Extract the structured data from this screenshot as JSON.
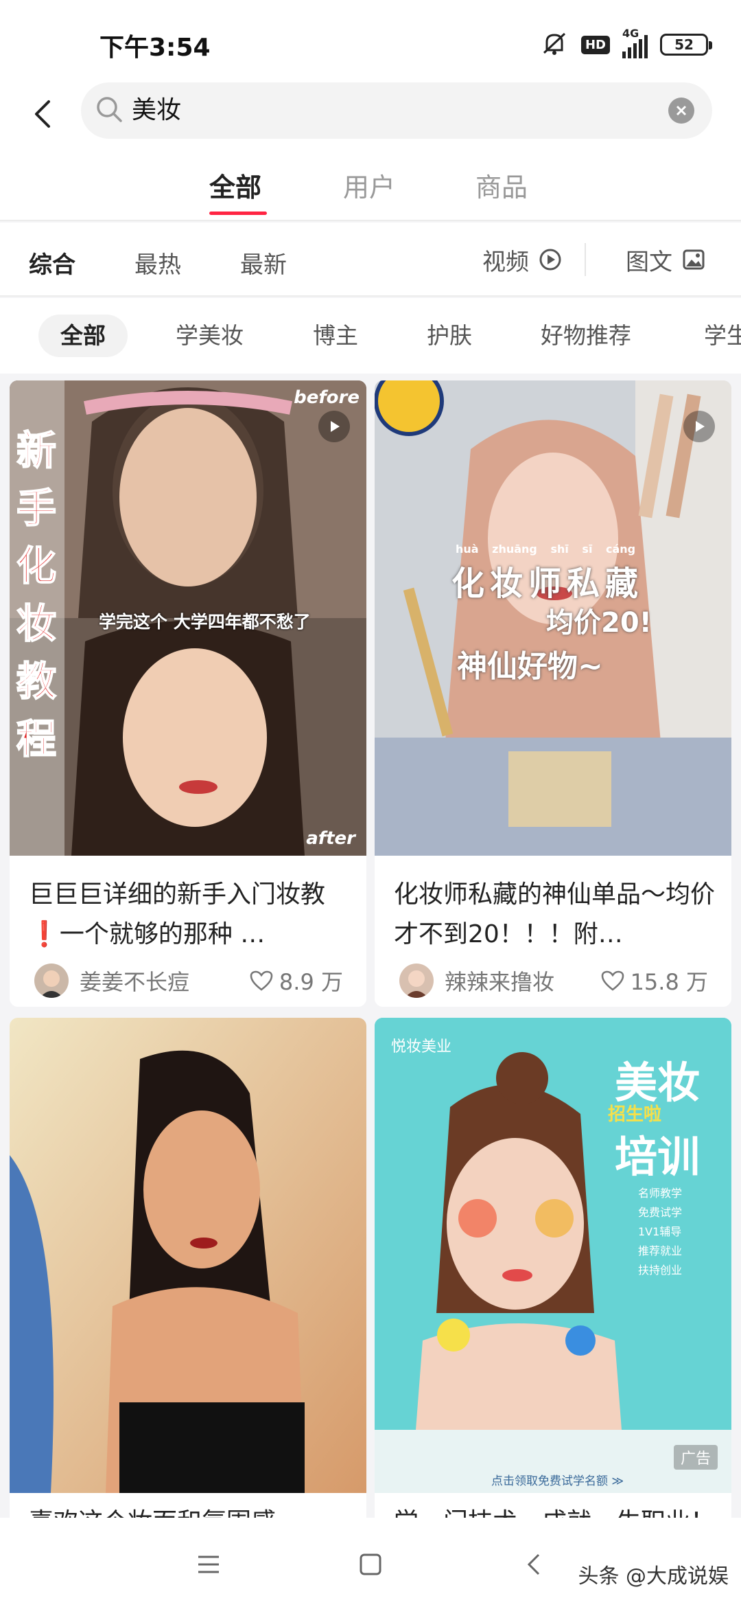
{
  "status_bar": {
    "time": "下午3:54",
    "hd": "HD",
    "network": "4G",
    "battery": "52"
  },
  "search": {
    "query": "美妆"
  },
  "primary_tabs": [
    {
      "label": "全部",
      "active": true
    },
    {
      "label": "用户",
      "active": false
    },
    {
      "label": "商品",
      "active": false
    }
  ],
  "sort": {
    "items": [
      "综合",
      "最热",
      "最新"
    ],
    "video": "视频",
    "image_text": "图文"
  },
  "chips": [
    "全部",
    "学美妆",
    "博主",
    "护肤",
    "好物推荐",
    "学生"
  ],
  "cards": [
    {
      "title": "巨巨巨详细的新手入门妆教❗️一个就够的那种 …",
      "author": "姜姜不长痘",
      "likes": "8.9 万",
      "overlay": {
        "side": "新手化妆教程",
        "caption": "学完这个 大学四年都不愁了",
        "before": "before",
        "after": "after"
      }
    },
    {
      "title": "化妆师私藏的神仙单品～均价才不到20！！！附…",
      "author": "辣辣来撸妆",
      "likes": "15.8 万",
      "overlay": {
        "pinyin": "huà zhuāng shī sī cáng",
        "line1": "化妆师私藏",
        "line2": "均价20!",
        "line3": "神仙好物~"
      }
    },
    {
      "title": "喜欢这个妆面和氛围感",
      "overlay": {}
    },
    {
      "title": "学一门技术，成就一生职业！",
      "overlay": {
        "brand": "悦妆美业",
        "big1": "美妆",
        "sub": "招生啦",
        "big2": "培训",
        "bullets": [
          "名师教学",
          "免费试学",
          "1V1辅导",
          "推荐就业",
          "扶持创业"
        ],
        "cta": "点击领取免费试学名额 ≫",
        "ad": "广告"
      }
    }
  ],
  "watermark": "头条 @大成说娱"
}
